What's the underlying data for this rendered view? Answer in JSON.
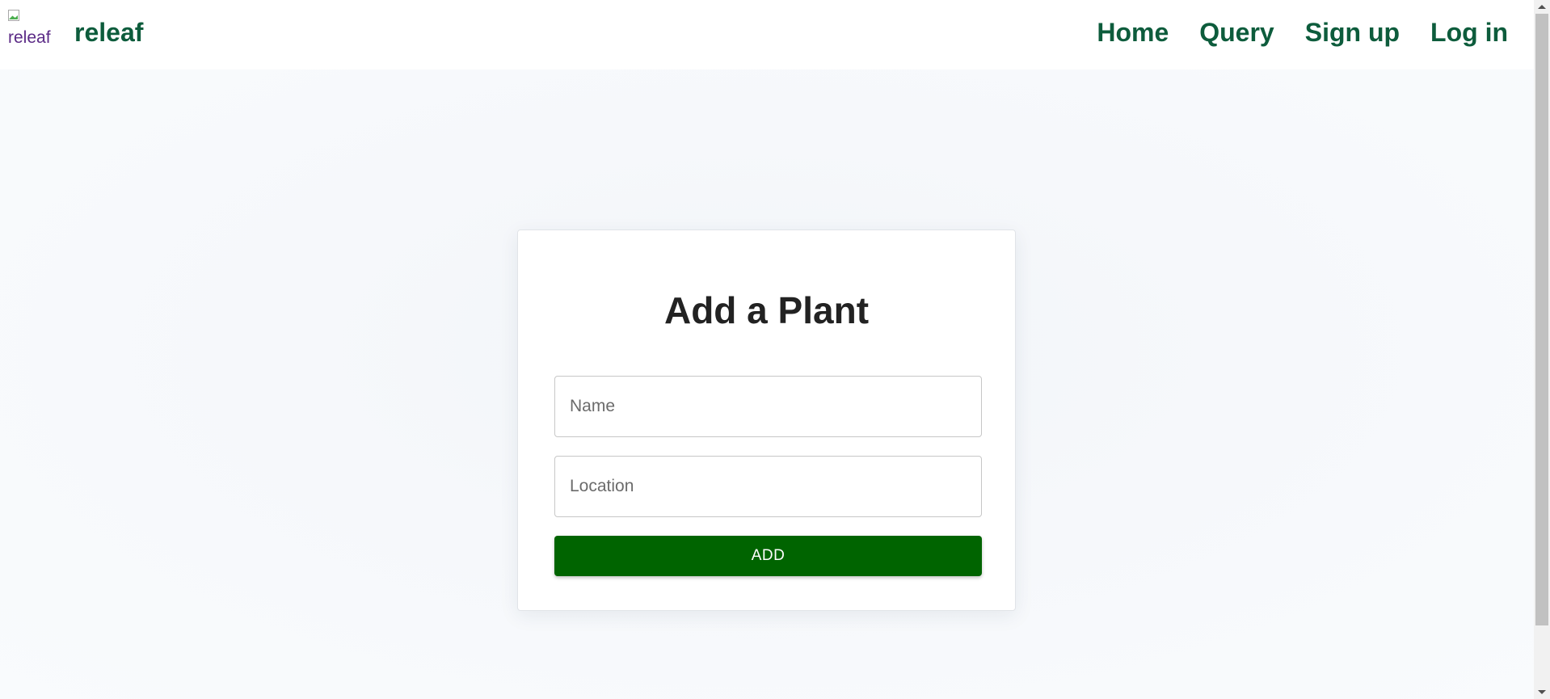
{
  "header": {
    "logo_alt": "releaf",
    "brand": "releaf",
    "nav": [
      {
        "label": "Home"
      },
      {
        "label": "Query"
      },
      {
        "label": "Sign up"
      },
      {
        "label": "Log in"
      }
    ]
  },
  "form": {
    "title": "Add a Plant",
    "name_placeholder": "Name",
    "location_placeholder": "Location",
    "submit_label": "ADD"
  },
  "colors": {
    "brand_green": "#0d5c3c",
    "button_green": "#006400",
    "title_text": "#222222"
  },
  "icons": {
    "logo": "broken-image-icon"
  }
}
